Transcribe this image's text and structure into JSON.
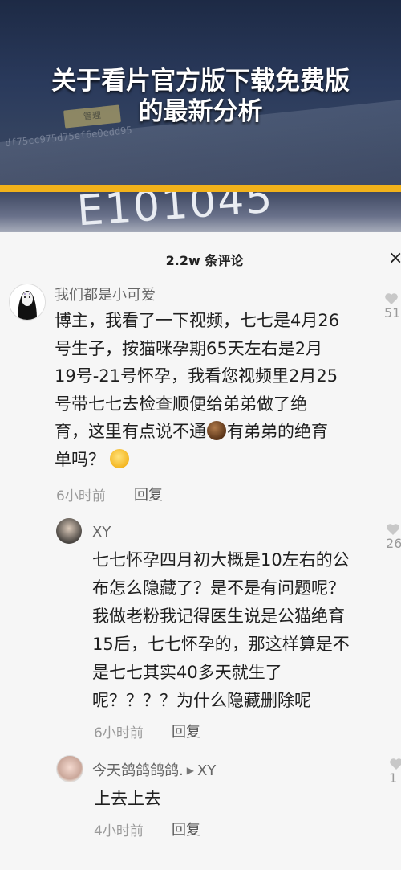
{
  "banner": {
    "title_line1": "关于看片官方版下载免费版",
    "title_line2": "的最新分析",
    "screen_text": "df75cc975d75ef6e0edd95",
    "screen_button": "管理",
    "big_number": "E101045"
  },
  "sheet": {
    "title": "2.2w 条评论",
    "close": "×"
  },
  "comments": [
    {
      "author": "我们都是小可爱",
      "lines": [
        "博主，我看了一下视频，七七是4月26",
        "号生子，按猫咪孕期65天左右是2月",
        "19号-21号怀孕，我看您视频里2月25",
        "号带七七去检查顺便给弟弟做了绝",
        "育，这里有点说不通",
        "有弟弟的绝育",
        "单吗？"
      ],
      "time": "6小时前",
      "reply": "回复",
      "likes": "51"
    },
    {
      "author": "XY",
      "lines": [
        "七七怀孕四月初大概是10左右的公",
        "布怎么隐藏了？是不是有问题呢？",
        "我做老粉我记得医生说是公猫绝育",
        "15后，七七怀孕的，那这样算是不",
        "是七七其实40多天就生了",
        "呢？？？？为什么隐藏删除呢"
      ],
      "time": "6小时前",
      "reply": "回复",
      "likes": "26"
    },
    {
      "author": "今天鸽鸽鸽鸽.",
      "reply_to": "XY",
      "lines": [
        "上去上去"
      ],
      "time": "4小时前",
      "reply": "回复",
      "likes": "1"
    }
  ],
  "colors": {
    "accent_bar": "#f2b21a",
    "text": "#1f1f1f",
    "meta": "#9a9a9a"
  }
}
